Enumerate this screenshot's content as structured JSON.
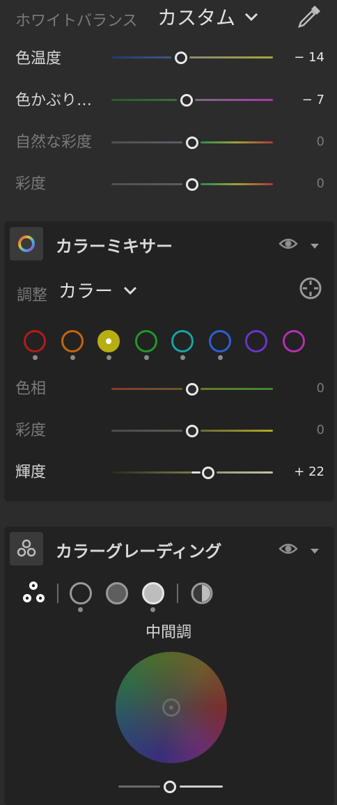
{
  "white_balance": {
    "label": "ホワイトバランス",
    "mode": "カスタム",
    "sliders": [
      {
        "label": "色温度",
        "value": "− 14",
        "level": 0.47
      },
      {
        "label": "色かぶり…",
        "value": "− 7",
        "level": 0.47
      },
      {
        "label": "自然な彩度",
        "value": "0",
        "level": 0.5
      },
      {
        "label": "彩度",
        "value": "0",
        "level": 0.5
      }
    ]
  },
  "color_mixer": {
    "title": "カラーミキサー",
    "adjust_label": "調整",
    "adjust_mode": "カラー",
    "swatches": [
      {
        "name": "red",
        "color": "#b31b1b",
        "selected": false,
        "dot": true
      },
      {
        "name": "orange",
        "color": "#c5650f",
        "selected": false,
        "dot": true
      },
      {
        "name": "yellow",
        "color": "#b7ae14",
        "selected": true,
        "dot": true
      },
      {
        "name": "green",
        "color": "#1e9a24",
        "selected": false,
        "dot": true
      },
      {
        "name": "aqua",
        "color": "#17a3a3",
        "selected": false,
        "dot": true
      },
      {
        "name": "blue",
        "color": "#2d5fd6",
        "selected": false,
        "dot": true
      },
      {
        "name": "purple",
        "color": "#6a35c8",
        "selected": false,
        "dot": false
      },
      {
        "name": "magenta",
        "color": "#b52fb2",
        "selected": false,
        "dot": false
      }
    ],
    "sliders": [
      {
        "label": "色相",
        "value": "0",
        "level": 0.5
      },
      {
        "label": "彩度",
        "value": "0",
        "level": 0.5
      },
      {
        "label": "輝度",
        "value": "+ 22",
        "level": 0.6
      }
    ]
  },
  "color_grading": {
    "title": "カラーグレーディング",
    "section_label": "中間調",
    "wheel_level": 0.5
  },
  "icons": {
    "dropdown": "chevron-down-icon",
    "eyedropper": "eyedropper-icon",
    "eye": "eye-icon",
    "collapse": "triangle-down-icon",
    "target": "target-adjust-icon"
  }
}
